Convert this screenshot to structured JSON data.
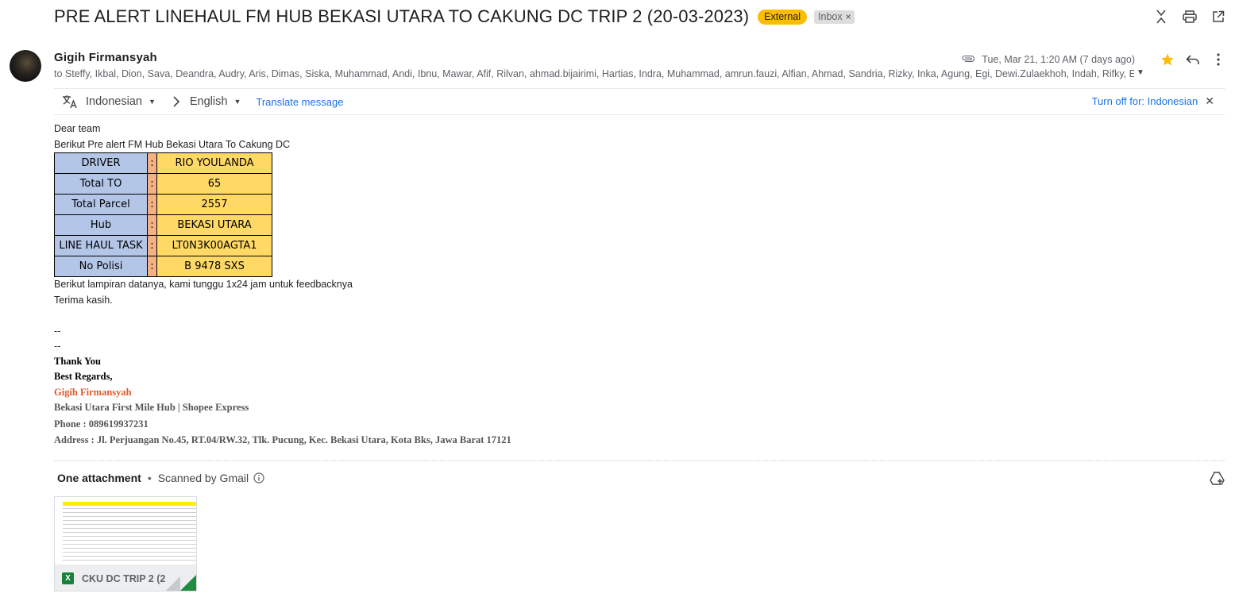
{
  "subject": {
    "title": "PRE ALERT LINEHAUL FM HUB BEKASI UTARA TO CAKUNG DC TRIP 2 (20-03-2023)",
    "badge_external": "External",
    "badge_inbox": "Inbox",
    "badge_inbox_close": "×"
  },
  "top_icons": [
    "expand-collapse-icon",
    "print-icon",
    "open-in-new-window-icon"
  ],
  "sender": {
    "name": "Gigih Firmansyah",
    "recipients": "to Steffy, Ikbal, Dion, Sava, Deandra, Audry, Aris, Dimas, Siska, Muhammad, Andi, Ibnu, Mawar, Afif, Rilvan, ahmad.bijairimi, Hartias, Indra, Muhammad, amrun.fauzi, Alfian, Ahmad, Sandria, Rizky, Inka, Agung, Egi, Dewi.Zulaekhoh, Indah, Rifky, Ega, Dhea",
    "date": "Tue, Mar 21, 1:20 AM (7 days ago)"
  },
  "translate": {
    "source_lang": "Indonesian",
    "target_lang": "English",
    "translate_link": "Translate message",
    "turn_off": "Turn off for: Indonesian"
  },
  "body": {
    "greeting": "Dear team",
    "intro": "Berikut Pre alert FM Hub Bekasi Utara To Cakung DC",
    "table": [
      {
        "label": "DRIVER",
        "sep": ":",
        "value": "RIO YOULANDA"
      },
      {
        "label": "Total TO",
        "sep": ":",
        "value": "65"
      },
      {
        "label": "Total Parcel",
        "sep": ":",
        "value": "2557"
      },
      {
        "label": "Hub",
        "sep": ":",
        "value": "BEKASI UTARA"
      },
      {
        "label": "LINE HAUL TASK",
        "sep": ":",
        "value": "LT0N3K00AGTA1"
      },
      {
        "label": "No Polisi",
        "sep": ":",
        "value": "B 9478 SXS"
      }
    ],
    "after_table": "Berikut lampiran datanya, kami tunggu 1x24 jam untuk feedbacknya",
    "thanks": "Terima kasih.",
    "dash1": "--",
    "dash2": "--"
  },
  "signature": {
    "thank_you": "Thank You",
    "regards": "Best Regards,",
    "name": "Gigih Firmansyah",
    "org": "Bekasi Utara First Mile Hub |  Shopee Express",
    "phone": "Phone : 089619937231",
    "address": "Address : Jl. Perjuangan No.45, RT.04/RW.32, Tlk. Pucung, Kec. Bekasi Utara, Kota Bks, Jawa Barat 17121",
    "name_color": "#e2582b",
    "text_color": "#555555"
  },
  "attachments": {
    "count_label": "One attachment",
    "scanned": "Scanned by Gmail",
    "file_name": "CKU DC TRIP 2 (2...",
    "file_type": "X"
  },
  "colors": {
    "external_badge": "#fbbc04",
    "link": "#1a73e8",
    "table_label_bg": "#b4c6e7",
    "table_sep_bg": "#f4b183",
    "table_value_bg": "#ffd966",
    "star": "#fbbc04"
  }
}
